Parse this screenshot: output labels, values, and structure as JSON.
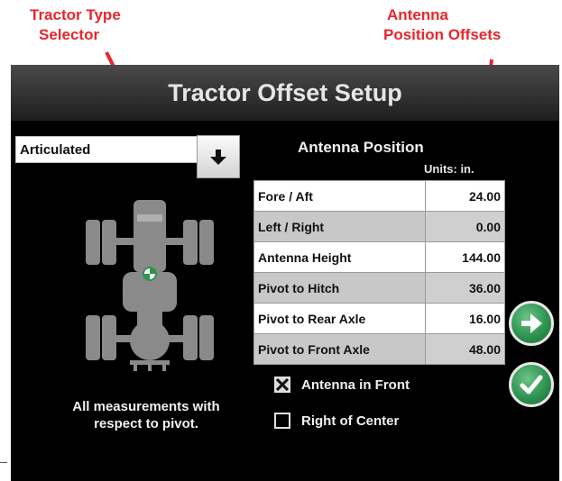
{
  "callouts": {
    "left_line1": "Tractor Type",
    "left_line2": "Selector",
    "right_line1": "Antenna",
    "right_line2": "Position Offsets",
    "color": "#e8262b"
  },
  "screen": {
    "title": "Tractor Offset Setup",
    "tractor_type": {
      "selected": "Articulated",
      "button_icon": "arrow-down-icon"
    },
    "antenna": {
      "heading": "Antenna Position",
      "units": "Units: in.",
      "rows": [
        {
          "label": "Fore / Aft",
          "value": "24.00"
        },
        {
          "label": "Left / Right",
          "value": "0.00"
        },
        {
          "label": "Antenna Height",
          "value": "144.00"
        },
        {
          "label": "Pivot to Hitch",
          "value": "36.00"
        },
        {
          "label": "Pivot to Rear Axle",
          "value": "16.00"
        },
        {
          "label": "Pivot to Front Axle",
          "value": "48.00"
        }
      ]
    },
    "options": {
      "antenna_in_front": {
        "label": "Antenna in Front",
        "checked": true
      },
      "right_of_center": {
        "label": "Right of Center",
        "checked": false
      }
    },
    "footnote_line1": "All measurements with",
    "footnote_line2": "respect to pivot.",
    "buttons": {
      "next_icon": "arrow-right-icon",
      "confirm_icon": "checkmark-icon",
      "accent": "#2f9350"
    }
  }
}
